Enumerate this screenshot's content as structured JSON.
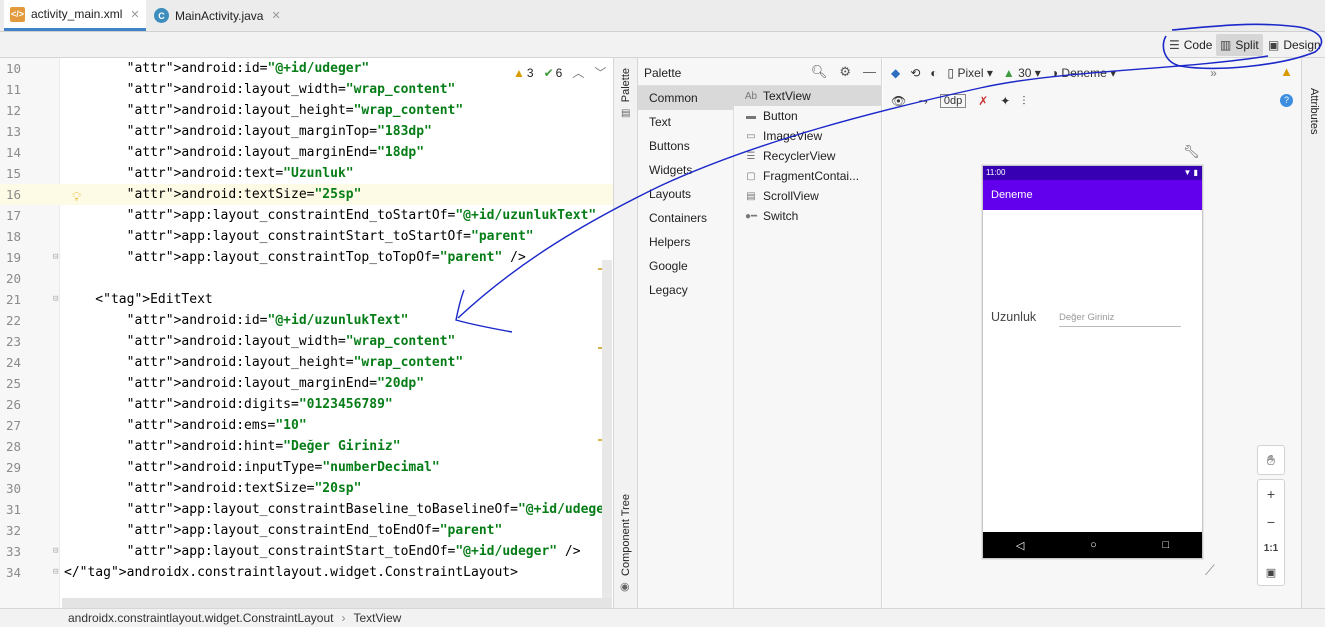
{
  "tabs": [
    {
      "label": "activity_main.xml",
      "icon": "xml-file-icon",
      "active": true
    },
    {
      "label": "MainActivity.java",
      "icon": "java-class-icon",
      "active": false
    }
  ],
  "view_modes": {
    "code": "Code",
    "split": "Split",
    "design": "Design",
    "selected": "Split"
  },
  "inspections": {
    "warnings": "3",
    "typos": "6"
  },
  "code_lines": [
    {
      "n": "10",
      "text": "        android:id=\"@+id/udeger\""
    },
    {
      "n": "11",
      "text": "        android:layout_width=\"wrap_content\""
    },
    {
      "n": "12",
      "text": "        android:layout_height=\"wrap_content\""
    },
    {
      "n": "13",
      "text": "        android:layout_marginTop=\"183dp\""
    },
    {
      "n": "14",
      "text": "        android:layout_marginEnd=\"18dp\""
    },
    {
      "n": "15",
      "text": "        android:text=\"Uzunluk\""
    },
    {
      "n": "16",
      "text": "        android:textSize=\"25sp\""
    },
    {
      "n": "17",
      "text": "        app:layout_constraintEnd_toStartOf=\"@+id/uzunlukText\""
    },
    {
      "n": "18",
      "text": "        app:layout_constraintStart_toStartOf=\"parent\""
    },
    {
      "n": "19",
      "text": "        app:layout_constraintTop_toTopOf=\"parent\" />"
    },
    {
      "n": "20",
      "text": ""
    },
    {
      "n": "21",
      "text": "    <EditText"
    },
    {
      "n": "22",
      "text": "        android:id=\"@+id/uzunlukText\""
    },
    {
      "n": "23",
      "text": "        android:layout_width=\"wrap_content\""
    },
    {
      "n": "24",
      "text": "        android:layout_height=\"wrap_content\""
    },
    {
      "n": "25",
      "text": "        android:layout_marginEnd=\"20dp\""
    },
    {
      "n": "26",
      "text": "        android:digits=\"0123456789\""
    },
    {
      "n": "27",
      "text": "        android:ems=\"10\""
    },
    {
      "n": "28",
      "text": "        android:hint=\"Değer Giriniz\""
    },
    {
      "n": "29",
      "text": "        android:inputType=\"numberDecimal\""
    },
    {
      "n": "30",
      "text": "        android:textSize=\"20sp\""
    },
    {
      "n": "31",
      "text": "        app:layout_constraintBaseline_toBaselineOf=\"@+id/udeger\""
    },
    {
      "n": "32",
      "text": "        app:layout_constraintEnd_toEndOf=\"parent\""
    },
    {
      "n": "33",
      "text": "        app:layout_constraintStart_toEndOf=\"@+id/udeger\" />"
    },
    {
      "n": "34",
      "text": "</androidx.constraintlayout.widget.ConstraintLayout>"
    }
  ],
  "side_strip": {
    "palette": "Palette",
    "component_tree": "Component Tree",
    "attributes": "Attributes"
  },
  "palette": {
    "title": "Palette",
    "categories": [
      "Common",
      "Text",
      "Buttons",
      "Widgets",
      "Layouts",
      "Containers",
      "Helpers",
      "Google",
      "Legacy"
    ],
    "selected_category": "Common",
    "items": [
      {
        "label": "TextView",
        "icon": "Ab"
      },
      {
        "label": "Button",
        "icon": "▬"
      },
      {
        "label": "ImageView",
        "icon": "▭"
      },
      {
        "label": "RecyclerView",
        "icon": "☰"
      },
      {
        "label": "FragmentContai...",
        "icon": "▢"
      },
      {
        "label": "ScrollView",
        "icon": "▤"
      },
      {
        "label": "Switch",
        "icon": "●━"
      }
    ]
  },
  "design_toolbar": {
    "device": "Pixel",
    "api": "30",
    "theme": "Deneme",
    "margin": "0dp"
  },
  "preview": {
    "status_time": "11:00",
    "app_title": "Deneme",
    "label": "Uzunluk",
    "hint": "Değer Giriniz"
  },
  "zoom": {
    "in": "+",
    "out": "−",
    "fit": "1:1"
  },
  "breadcrumb": [
    "androidx.constraintlayout.widget.ConstraintLayout",
    "TextView"
  ],
  "colors": {
    "status_bar": "#3700b3",
    "app_bar": "#6200ee",
    "annotation": "#1a27c9"
  }
}
